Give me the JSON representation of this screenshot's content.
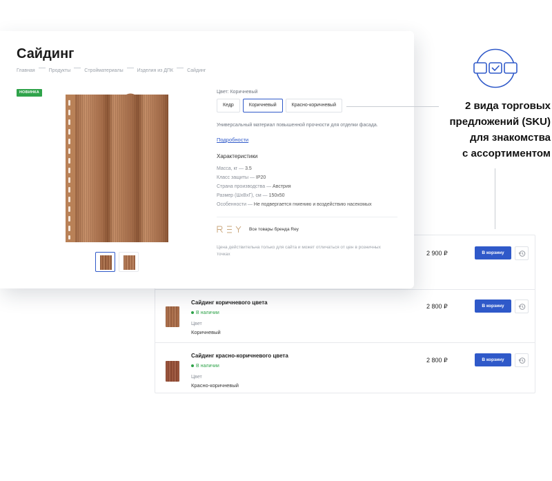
{
  "product": {
    "title": "Сайдинг",
    "breadcrumb": [
      "Главная",
      "Продукты",
      "Стройматериалы",
      "Изделия из ДПК",
      "Сайдинг"
    ],
    "badge": "НОВИНКА",
    "color_caption": "Цвет: Коричневый",
    "swatches": [
      "Кедр",
      "Коричневый",
      "Красно-коричневый"
    ],
    "selected_swatch": "Коричневый",
    "description": "Универсальный материал повышенной прочности для отделки фасада.",
    "more_link": "Подробности",
    "specs_title": "Характеристики",
    "specs": [
      {
        "label": "Масса, кг — ",
        "value": "3.5"
      },
      {
        "label": "Класс защиты — ",
        "value": "IP20"
      },
      {
        "label": "Страна производства — ",
        "value": "Австрия"
      },
      {
        "label": "Размер (ШхВхГ), см — ",
        "value": "150х50"
      },
      {
        "label": "Особенности — ",
        "value": "Не подвергается гниению и воздействию насекомых"
      }
    ],
    "brand_logo_text": "REY",
    "brand_link": "Все товары бренда Rey",
    "price_note": "Цена действительна только для сайта и может отличаться от цен в розничных точках",
    "image_color": "#b47a55"
  },
  "offers": [
    {
      "name": "",
      "stock": "",
      "color_label": "",
      "color_value": "",
      "price": "2 900 ₽",
      "cart_label": "В корзину"
    },
    {
      "name": "Сайдинг коричневого цвета",
      "stock": "В наличии",
      "color_label": "Цвет",
      "color_value": "Коричневый",
      "price": "2 800 ₽",
      "cart_label": "В корзину"
    },
    {
      "name": "Сайдинг красно-коричневого цвета",
      "stock": "В наличии",
      "color_label": "Цвет",
      "color_value": "Красно-коричневый",
      "price": "2 800 ₽",
      "cart_label": "В корзину"
    }
  ],
  "callout": {
    "lines": [
      "2 вида торговых",
      "предложений (SKU)",
      "для знакомства",
      "с ассортиментом"
    ],
    "icon": "sku-selection-icon"
  },
  "colors": {
    "accent": "#2f59c9",
    "badge": "#2fa34a",
    "in_stock": "#2fa34a"
  }
}
